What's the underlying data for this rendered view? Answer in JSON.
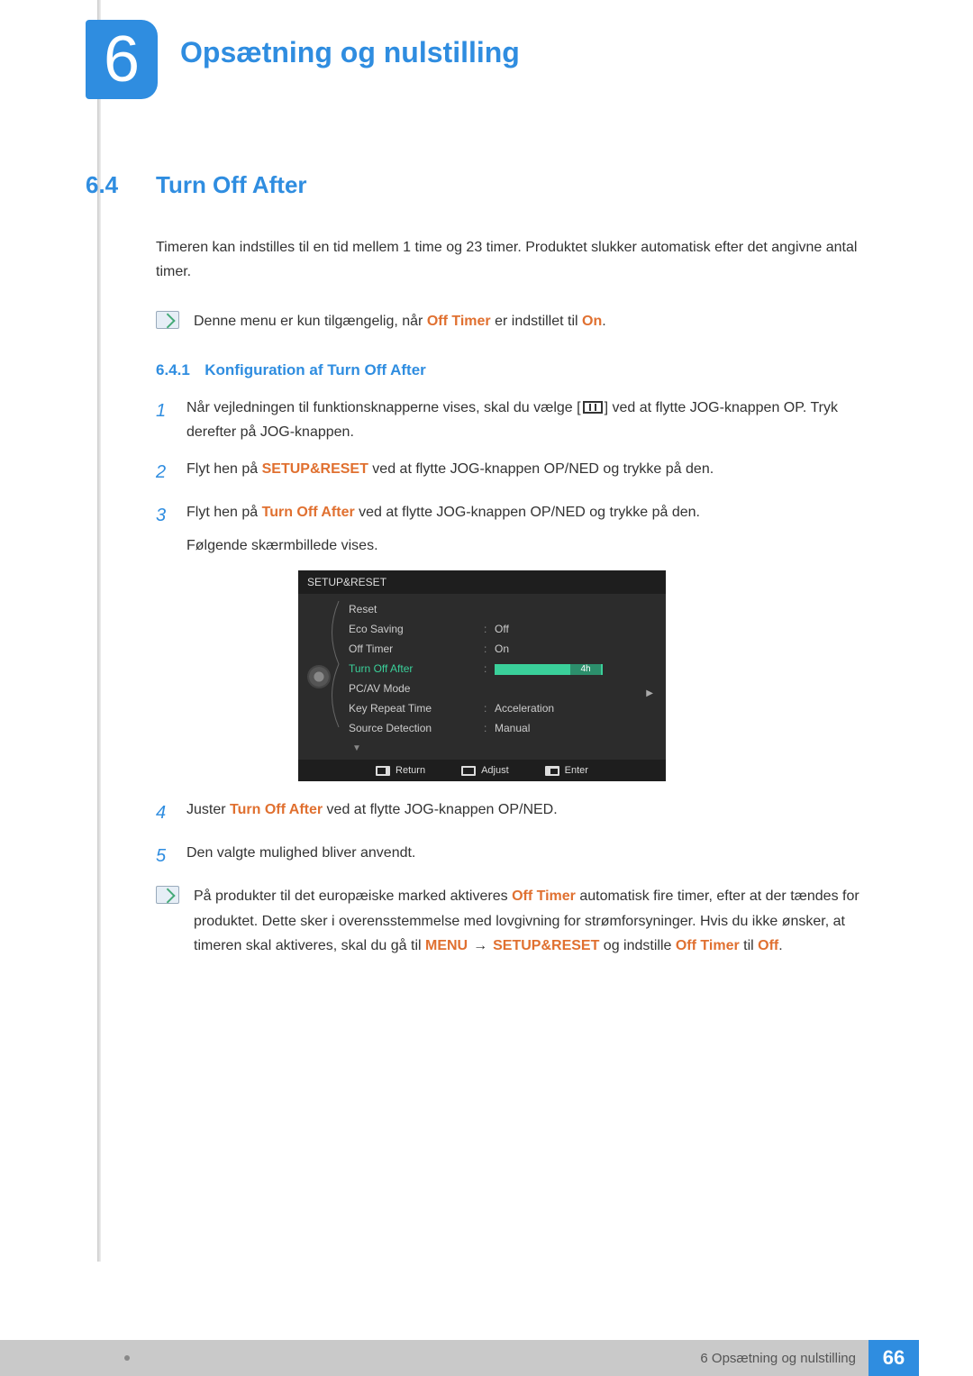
{
  "chapter": {
    "number": "6",
    "title": "Opsætning og nulstilling"
  },
  "section": {
    "number": "6.4",
    "title": "Turn Off After"
  },
  "intro": "Timeren kan indstilles til en tid mellem 1 time og 23 timer. Produktet slukker automatisk efter det angivne antal timer.",
  "note1": {
    "pre": "Denne menu er kun tilgængelig, når ",
    "strong1": "Off Timer",
    "mid": " er indstillet til ",
    "strong2": "On",
    "post": "."
  },
  "subsection": {
    "number": "6.4.1",
    "title": "Konfiguration af Turn Off After"
  },
  "steps": {
    "s1a": "Når vejledningen til funktionsknapperne vises, skal du vælge [",
    "s1b": "] ved at flytte JOG-knappen OP. Tryk derefter på JOG-knappen.",
    "s2a": "Flyt hen på ",
    "s2b": "SETUP&RESET",
    "s2c": " ved at flytte JOG-knappen OP/NED og trykke på den.",
    "s3a": "Flyt hen på ",
    "s3b": "Turn Off After",
    "s3c": " ved at flytte JOG-knappen OP/NED og trykke på den.",
    "s3d": "Følgende skærmbillede vises.",
    "s4a": "Juster ",
    "s4b": "Turn Off After",
    "s4c": " ved at flytte JOG-knappen OP/NED.",
    "s5": "Den valgte mulighed bliver anvendt.",
    "nums": {
      "n1": "1",
      "n2": "2",
      "n3": "3",
      "n4": "4",
      "n5": "5"
    }
  },
  "note2": {
    "t1": "På produkter til det europæiske marked aktiveres ",
    "s1": "Off Timer",
    "t2": " automatisk fire timer, efter at der tændes for produktet. Dette sker i overensstemmelse med lovgivning for strømforsyninger. Hvis du ikke ønsker, at timeren skal aktiveres, skal du gå til ",
    "s2": "MENU",
    "arrow": "→",
    "s3": "SETUP&RESET",
    "t3": " og indstille ",
    "s4": "Off Timer",
    "t4": " til ",
    "s5": "Off",
    "t5": "."
  },
  "osd": {
    "header": "SETUP&RESET",
    "rows": {
      "reset": "Reset",
      "eco": "Eco Saving",
      "eco_v": "Off",
      "offtimer": "Off Timer",
      "offtimer_v": "On",
      "turnoff": "Turn Off After",
      "turnoff_v": "4h",
      "pcav": "PC/AV Mode",
      "keyrep": "Key Repeat Time",
      "keyrep_v": "Acceleration",
      "srcdet": "Source Detection",
      "srcdet_v": "Manual",
      "down": "▼"
    },
    "footer": {
      "return": "Return",
      "adjust": "Adjust",
      "enter": "Enter"
    }
  },
  "footer": {
    "chapter_label": "6 Opsætning og nulstilling",
    "page": "66"
  }
}
